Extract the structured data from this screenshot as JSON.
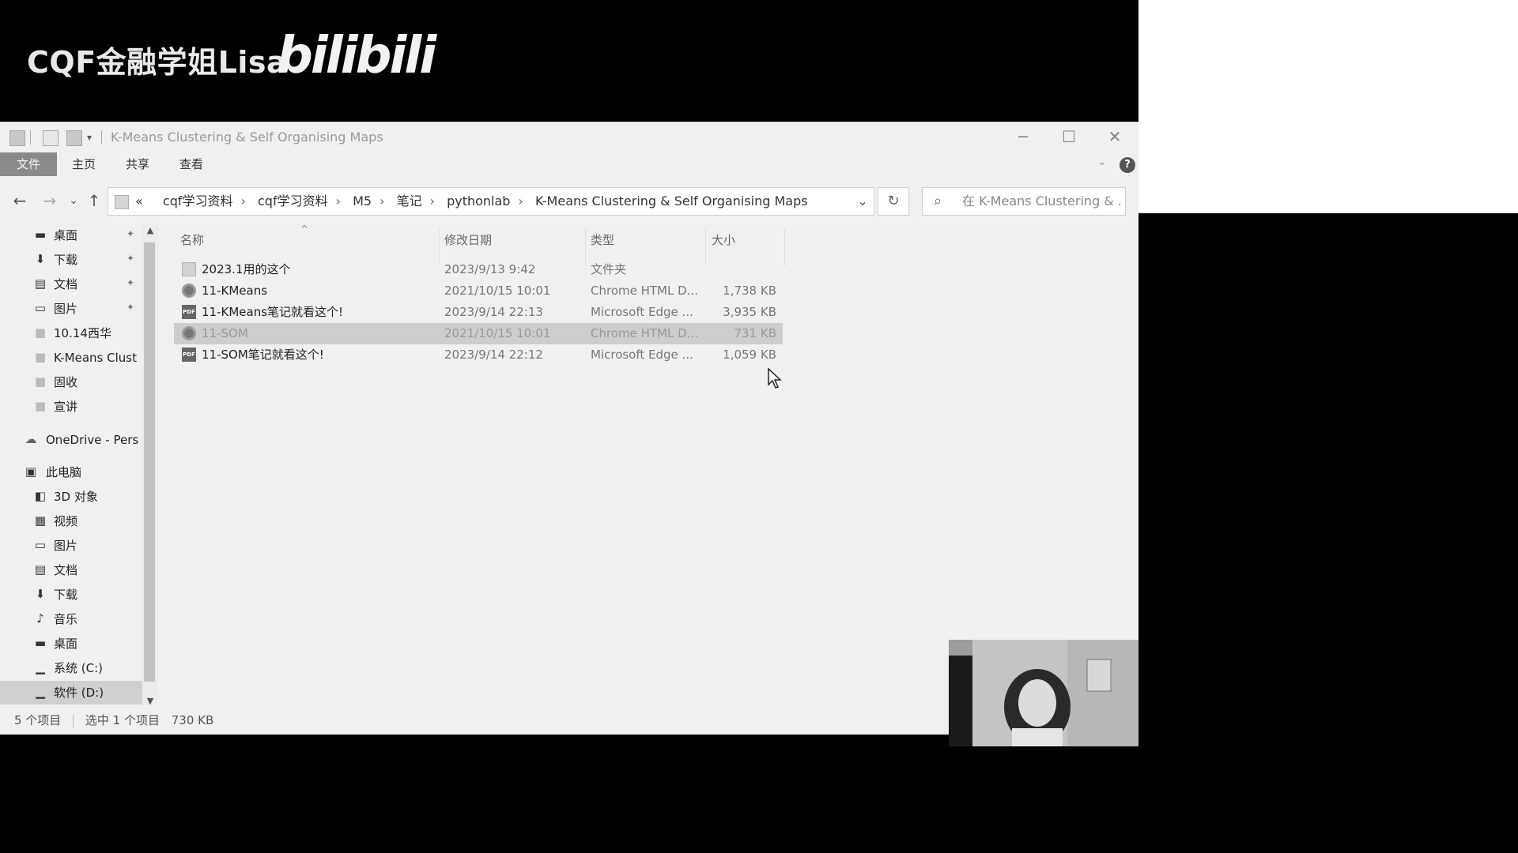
{
  "watermark": {
    "text": "CQF金融学姐Lisa",
    "logo": "bilibili"
  },
  "window": {
    "title": "K-Means Clustering & Self Organising Maps",
    "controls": {
      "minimize": "─",
      "maximize": "☐",
      "close": "✕"
    }
  },
  "ribbon": {
    "tabs": [
      "文件",
      "主页",
      "共享",
      "查看"
    ],
    "help": "?"
  },
  "nav": {
    "back": "←",
    "forward": "→",
    "recent": "⌄",
    "up": "↑",
    "breadcrumb_prefix": "«",
    "breadcrumbs": [
      "cqf学习资料",
      "cqf学习资料",
      "M5",
      "笔记",
      "pythonlab",
      "K-Means Clustering & Self Organising Maps"
    ],
    "refresh": "↻",
    "search_placeholder": "在 K-Means Clustering & ..."
  },
  "sidebar": {
    "quick_access": [
      {
        "label": "桌面",
        "icon": "desktop-icon",
        "pinned": true
      },
      {
        "label": "下载",
        "icon": "download-icon",
        "pinned": true
      },
      {
        "label": "文档",
        "icon": "document-icon",
        "pinned": true
      },
      {
        "label": "图片",
        "icon": "pictures-icon",
        "pinned": true
      },
      {
        "label": "10.14西华",
        "icon": "folder-icon",
        "pinned": false
      },
      {
        "label": "K-Means Clust",
        "icon": "folder-icon",
        "pinned": false
      },
      {
        "label": "固收",
        "icon": "folder-icon",
        "pinned": false
      },
      {
        "label": "宣讲",
        "icon": "folder-icon",
        "pinned": false
      }
    ],
    "onedrive": "OneDrive - Pers",
    "this_pc": "此电脑",
    "pc_items": [
      {
        "label": "3D 对象",
        "icon": "3d-objects-icon"
      },
      {
        "label": "视频",
        "icon": "videos-icon"
      },
      {
        "label": "图片",
        "icon": "pictures-icon"
      },
      {
        "label": "文档",
        "icon": "document-icon"
      },
      {
        "label": "下载",
        "icon": "download-icon"
      },
      {
        "label": "音乐",
        "icon": "music-icon"
      },
      {
        "label": "桌面",
        "icon": "desktop-icon"
      },
      {
        "label": "系统 (C:)",
        "icon": "drive-icon"
      },
      {
        "label": "软件 (D:)",
        "icon": "drive-icon",
        "selected": true
      }
    ]
  },
  "filelist": {
    "columns": [
      "名称",
      "修改日期",
      "类型",
      "大小"
    ],
    "rows": [
      {
        "name": "2023.1用的这个",
        "date": "2023/9/13 9:42",
        "type": "文件夹",
        "size": "",
        "icon": "folder"
      },
      {
        "name": "11-KMeans",
        "date": "2021/10/15 10:01",
        "type": "Chrome HTML D...",
        "size": "1,738 KB",
        "icon": "chrome"
      },
      {
        "name": "11-KMeans笔记就看这个!",
        "date": "2023/9/14 22:13",
        "type": "Microsoft Edge ...",
        "size": "3,935 KB",
        "icon": "pdf"
      },
      {
        "name": "11-SOM",
        "date": "2021/10/15 10:01",
        "type": "Chrome HTML D...",
        "size": "731 KB",
        "icon": "chrome",
        "selected": true
      },
      {
        "name": "11-SOM笔记就看这个!",
        "date": "2023/9/14 22:12",
        "type": "Microsoft Edge ...",
        "size": "1,059 KB",
        "icon": "pdf"
      }
    ]
  },
  "status": {
    "count": "5 个项目",
    "selected": "选中 1 个项目",
    "size": "730 KB"
  }
}
